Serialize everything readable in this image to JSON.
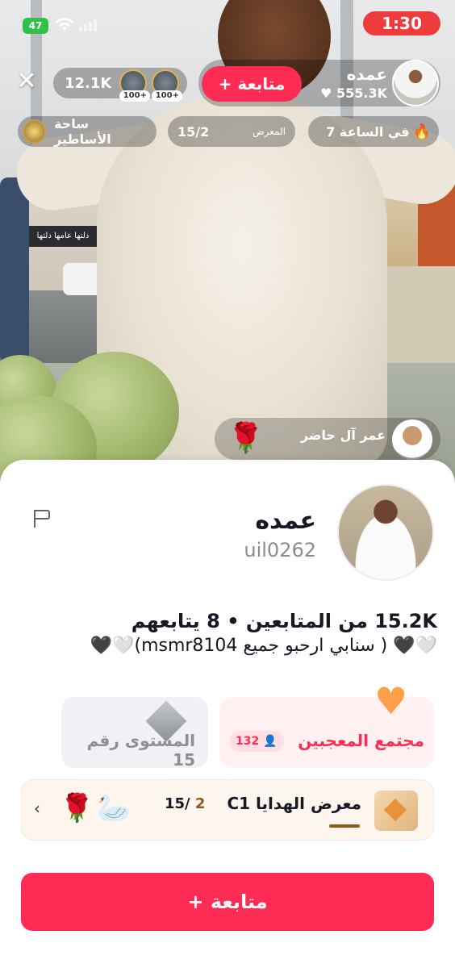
{
  "status_bar": {
    "battery": "47",
    "time": "1:30"
  },
  "live": {
    "viewer_count": "12.1K",
    "viewer_badges": [
      "100+",
      "100+"
    ],
    "follow_label": "+ متابعة",
    "host_name": "عمده",
    "host_likes": "555.3K",
    "legends_chip": "ساحة الأساطير",
    "gallery_chip": {
      "label": "المعرض",
      "value": "15/2"
    },
    "rank_chip": "7 في الساعة",
    "gift_sender": "عمر آل حاضر",
    "background_sign": "دلتها عامها دلتها"
  },
  "profile": {
    "name": "عمده",
    "username": "uil0262",
    "stats": "15.2K من المتابعين • 8 يتابعهم",
    "bio": "🤍🖤 ( سنابي ارحبو جميع msmr8104)🤍🖤",
    "level_label": "المستوى رقم 15",
    "fans_label": "مجتمع المعجبين",
    "fans_count": "132",
    "gifts_label": "C1 معرض الهدايا",
    "gifts_progress_done": "2",
    "gifts_progress_total": "15/",
    "follow_button": "+ متابعة"
  },
  "colors": {
    "primary": "#fe2c55",
    "time_pill": "#ee3b3b",
    "battery": "#30c14a"
  },
  "icons": [
    "close-icon",
    "flag-icon",
    "heart-icon",
    "diamond-icon",
    "chevron-left-icon",
    "flame-icon",
    "person-icon"
  ]
}
